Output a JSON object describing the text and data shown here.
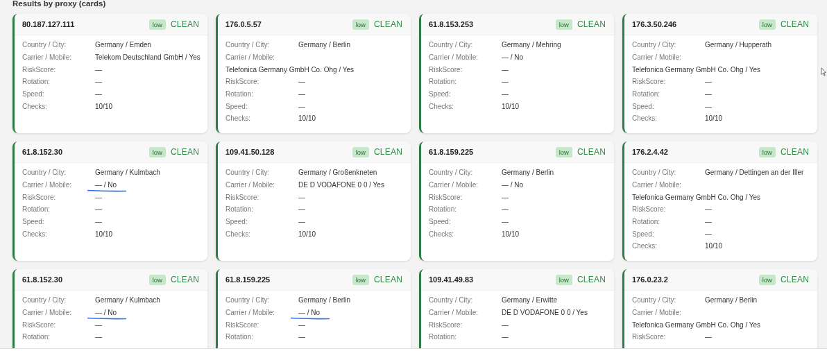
{
  "section_title": "Results by proxy (cards)",
  "cards": [
    {
      "ip": "80.187.127.111",
      "risk": "low",
      "status": "CLEAN",
      "carrier_underlined": false,
      "fields": [
        {
          "label": "Country / City:",
          "value": "Germany / Emden",
          "kind": "inline"
        },
        {
          "label": "Carrier / Mobile:",
          "value": "Telekom Deutschland GmbH / Yes",
          "kind": "inline"
        },
        {
          "label": "RiskScore:",
          "value": "—",
          "kind": "inline"
        },
        {
          "label": "Rotation:",
          "value": "—",
          "kind": "inline"
        },
        {
          "label": "Speed:",
          "value": "—",
          "kind": "inline"
        },
        {
          "label": "Checks:",
          "value": "10/10",
          "kind": "inline"
        }
      ]
    },
    {
      "ip": "176.0.5.57",
      "risk": "low",
      "status": "CLEAN",
      "carrier_underlined": false,
      "fields": [
        {
          "label": "Country / City:",
          "value": "Germany / Berlin",
          "kind": "inline"
        },
        {
          "label": "Carrier / Mobile:",
          "value": "Telefonica Germany GmbH Co. Ohg / Yes",
          "kind": "stacked"
        },
        {
          "label": "RiskScore:",
          "value": "—",
          "kind": "inline"
        },
        {
          "label": "Rotation:",
          "value": "—",
          "kind": "inline"
        },
        {
          "label": "Speed:",
          "value": "—",
          "kind": "inline"
        },
        {
          "label": "Checks:",
          "value": "10/10",
          "kind": "inline"
        }
      ]
    },
    {
      "ip": "61.8.153.253",
      "risk": "low",
      "status": "CLEAN",
      "carrier_underlined": false,
      "fields": [
        {
          "label": "Country / City:",
          "value": "Germany / Mehring",
          "kind": "inline"
        },
        {
          "label": "Carrier / Mobile:",
          "value": "— / No",
          "kind": "inline"
        },
        {
          "label": "RiskScore:",
          "value": "—",
          "kind": "inline"
        },
        {
          "label": "Rotation:",
          "value": "—",
          "kind": "inline"
        },
        {
          "label": "Speed:",
          "value": "—",
          "kind": "inline"
        },
        {
          "label": "Checks:",
          "value": "10/10",
          "kind": "inline"
        }
      ]
    },
    {
      "ip": "176.3.50.246",
      "risk": "low",
      "status": "CLEAN",
      "carrier_underlined": false,
      "fields": [
        {
          "label": "Country / City:",
          "value": "Germany / Hupperath",
          "kind": "inline"
        },
        {
          "label": "Carrier / Mobile:",
          "value": "Telefonica Germany GmbH Co. Ohg / Yes",
          "kind": "stacked"
        },
        {
          "label": "RiskScore:",
          "value": "—",
          "kind": "inline"
        },
        {
          "label": "Rotation:",
          "value": "—",
          "kind": "inline"
        },
        {
          "label": "Speed:",
          "value": "—",
          "kind": "inline"
        },
        {
          "label": "Checks:",
          "value": "10/10",
          "kind": "inline"
        }
      ]
    },
    {
      "ip": "61.8.152.30",
      "risk": "low",
      "status": "CLEAN",
      "carrier_underlined": true,
      "fields": [
        {
          "label": "Country / City:",
          "value": "Germany / Kulmbach",
          "kind": "inline"
        },
        {
          "label": "Carrier / Mobile:",
          "value": "— / No",
          "kind": "inline"
        },
        {
          "label": "RiskScore:",
          "value": "—",
          "kind": "inline"
        },
        {
          "label": "Rotation:",
          "value": "—",
          "kind": "inline"
        },
        {
          "label": "Speed:",
          "value": "—",
          "kind": "inline"
        },
        {
          "label": "Checks:",
          "value": "10/10",
          "kind": "inline"
        }
      ]
    },
    {
      "ip": "109.41.50.128",
      "risk": "low",
      "status": "CLEAN",
      "carrier_underlined": false,
      "fields": [
        {
          "label": "Country / City:",
          "value": "Germany / Großenkneten",
          "kind": "inline"
        },
        {
          "label": "Carrier / Mobile:",
          "value": "DE D VODAFONE 0 0 / Yes",
          "kind": "inline"
        },
        {
          "label": "RiskScore:",
          "value": "—",
          "kind": "inline"
        },
        {
          "label": "Rotation:",
          "value": "—",
          "kind": "inline"
        },
        {
          "label": "Speed:",
          "value": "—",
          "kind": "inline"
        },
        {
          "label": "Checks:",
          "value": "10/10",
          "kind": "inline"
        }
      ]
    },
    {
      "ip": "61.8.159.225",
      "risk": "low",
      "status": "CLEAN",
      "carrier_underlined": false,
      "fields": [
        {
          "label": "Country / City:",
          "value": "Germany / Berlin",
          "kind": "inline"
        },
        {
          "label": "Carrier / Mobile:",
          "value": "— / No",
          "kind": "inline"
        },
        {
          "label": "RiskScore:",
          "value": "—",
          "kind": "inline"
        },
        {
          "label": "Rotation:",
          "value": "—",
          "kind": "inline"
        },
        {
          "label": "Speed:",
          "value": "—",
          "kind": "inline"
        },
        {
          "label": "Checks:",
          "value": "10/10",
          "kind": "inline"
        }
      ]
    },
    {
      "ip": "176.2.4.42",
      "risk": "low",
      "status": "CLEAN",
      "carrier_underlined": false,
      "fields": [
        {
          "label": "Country / City:",
          "value": "Germany / Dettingen an der Iller",
          "kind": "inline"
        },
        {
          "label": "Carrier / Mobile:",
          "value": "Telefonica Germany GmbH Co. Ohg / Yes",
          "kind": "stacked"
        },
        {
          "label": "RiskScore:",
          "value": "—",
          "kind": "inline"
        },
        {
          "label": "Rotation:",
          "value": "—",
          "kind": "inline"
        },
        {
          "label": "Speed:",
          "value": "—",
          "kind": "inline"
        },
        {
          "label": "Checks:",
          "value": "10/10",
          "kind": "inline"
        }
      ]
    },
    {
      "ip": "61.8.152.30",
      "risk": "low",
      "status": "CLEAN",
      "carrier_underlined": true,
      "fields": [
        {
          "label": "Country / City:",
          "value": "Germany / Kulmbach",
          "kind": "inline"
        },
        {
          "label": "Carrier / Mobile:",
          "value": "— / No",
          "kind": "inline"
        },
        {
          "label": "RiskScore:",
          "value": "—",
          "kind": "inline"
        },
        {
          "label": "Rotation:",
          "value": "—",
          "kind": "inline"
        }
      ]
    },
    {
      "ip": "61.8.159.225",
      "risk": "low",
      "status": "CLEAN",
      "carrier_underlined": true,
      "fields": [
        {
          "label": "Country / City:",
          "value": "Germany / Berlin",
          "kind": "inline"
        },
        {
          "label": "Carrier / Mobile:",
          "value": "— / No",
          "kind": "inline"
        },
        {
          "label": "RiskScore:",
          "value": "—",
          "kind": "inline"
        },
        {
          "label": "Rotation:",
          "value": "—",
          "kind": "inline"
        }
      ]
    },
    {
      "ip": "109.41.49.83",
      "risk": "low",
      "status": "CLEAN",
      "carrier_underlined": false,
      "fields": [
        {
          "label": "Country / City:",
          "value": "Germany / Erwitte",
          "kind": "inline"
        },
        {
          "label": "Carrier / Mobile:",
          "value": "DE D VODAFONE 0 0 / Yes",
          "kind": "inline"
        },
        {
          "label": "RiskScore:",
          "value": "—",
          "kind": "inline"
        },
        {
          "label": "Rotation:",
          "value": "—",
          "kind": "inline"
        }
      ]
    },
    {
      "ip": "176.0.23.2",
      "risk": "low",
      "status": "CLEAN",
      "carrier_underlined": false,
      "fields": [
        {
          "label": "Country / City:",
          "value": "Germany / Berlin",
          "kind": "inline"
        },
        {
          "label": "Carrier / Mobile:",
          "value": "Telefonica Germany GmbH Co. Ohg / Yes",
          "kind": "stacked"
        },
        {
          "label": "RiskScore:",
          "value": "—",
          "kind": "inline"
        }
      ]
    }
  ]
}
